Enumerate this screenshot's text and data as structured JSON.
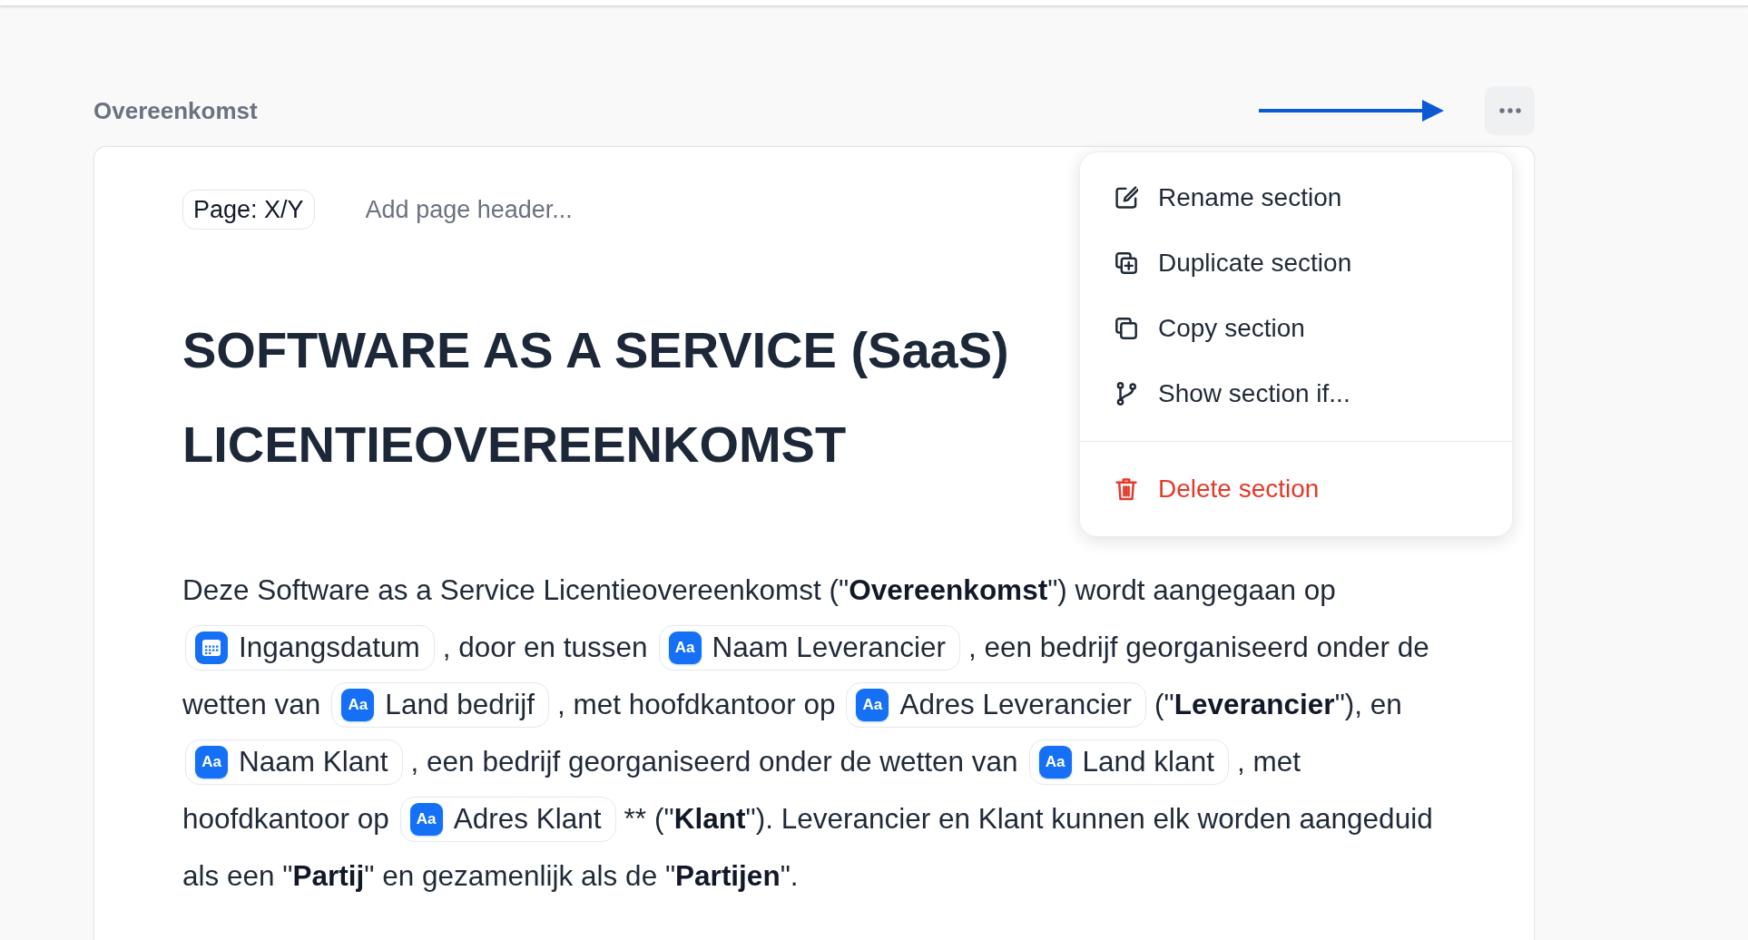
{
  "section": {
    "title": "Overeenkomst"
  },
  "context_menu": {
    "items": [
      {
        "label": "Rename section",
        "kind": "normal"
      },
      {
        "label": "Duplicate section",
        "kind": "normal"
      },
      {
        "label": "Copy section",
        "kind": "normal"
      },
      {
        "label": "Show section if...",
        "kind": "normal"
      },
      {
        "label": "Delete section",
        "kind": "danger"
      }
    ]
  },
  "page_header": {
    "page_chip": "Page: X/Y",
    "header_field": {
      "placeholder": "Add page header..."
    }
  },
  "document": {
    "title": "SOFTWARE AS A SERVICE (SaaS) LICENTIEOVEREENKOMST",
    "paragraph": {
      "lines": [
        [
          {
            "kind": "text",
            "text": "Deze Software as a Service Licentieovereenkomst (\"**Overeenkomst**\") wordt aangegaan op"
          }
        ],
        [
          {
            "kind": "date_field",
            "label": "Ingangsdatum"
          },
          {
            "kind": "text",
            "text": ", door en tussen"
          },
          {
            "kind": "text_field",
            "glyph": "Aa",
            "label": "Naam Leverancier"
          },
          {
            "kind": "text",
            "text": ", een bedrijf georganiseerd onder de"
          }
        ],
        [
          {
            "kind": "text",
            "text": "wetten van"
          },
          {
            "kind": "text_field",
            "glyph": "Aa",
            "label": "Land bedrijf"
          },
          {
            "kind": "text",
            "text": ", met hoofdkantoor op"
          },
          {
            "kind": "text_field",
            "glyph": "Aa",
            "label": "Adres Leverancier"
          },
          {
            "kind": "text",
            "text": "(\"**Leverancier**\"), en"
          }
        ],
        [
          {
            "kind": "text_field",
            "glyph": "Aa",
            "label": "Naam Klant"
          },
          {
            "kind": "text",
            "text": ", een bedrijf georganiseerd onder de wetten van"
          },
          {
            "kind": "text_field",
            "glyph": "Aa",
            "label": "Land klant"
          },
          {
            "kind": "text",
            "text": ", met"
          }
        ],
        [
          {
            "kind": "text",
            "text": "hoofdkantoor op"
          },
          {
            "kind": "text_field",
            "glyph": "Aa",
            "label": "Adres Klant"
          },
          {
            "kind": "literal",
            "text": "**"
          },
          {
            "kind": "text",
            "text": "(\"**Klant**\"). Leverancier en Klant kunnen elk worden aangeduid"
          }
        ],
        [
          {
            "kind": "text",
            "text": "als een \"**Partij**\" en gezamenlijk als de \"**Partijen**\"."
          }
        ]
      ]
    }
  }
}
